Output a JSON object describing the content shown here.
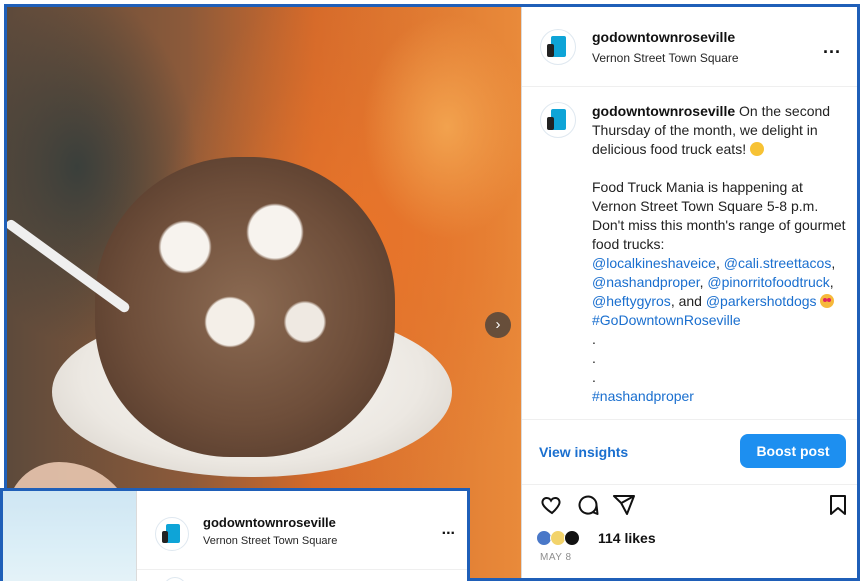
{
  "post": {
    "username": "godowntownroseville",
    "location": "Vernon Street Town Square",
    "more_label": "...",
    "caption": {
      "username": "godowntownroseville",
      "line1": "On the second Thursday of the month, we delight in delicious food truck eats!",
      "para2": "Food Truck Mania is happening at Vernon Street Town Square 5-8 p.m. Don't miss this month's range of gourmet food trucks:",
      "mentions": [
        "@localkineshaveice",
        "@cali.streettacos",
        "@nashandproper",
        "@pinorritofoodtruck",
        "@heftygyros",
        "@parkershotdogs"
      ],
      "and_word": "and",
      "hashtag1": "#GoDowntownRoseville",
      "dots": [
        ".",
        ".",
        "."
      ],
      "hashtag2": "#nashandproper"
    },
    "view_insights": "View insights",
    "boost_post": "Boost post",
    "likes": "114 likes",
    "date": "MAY 8",
    "carousel_next": "›",
    "icons": {
      "like": "heart-icon",
      "comment": "comment-icon",
      "share": "share-icon",
      "save": "bookmark-icon",
      "next": "chevron-right-icon",
      "more": "more-icon"
    },
    "colors": {
      "accent": "#1d8ff0",
      "link": "#1a6fcf",
      "border": "#1f5fb8"
    }
  },
  "second_post": {
    "username": "godowntownroseville",
    "location": "Vernon Street Town Square",
    "more_label": "..."
  }
}
